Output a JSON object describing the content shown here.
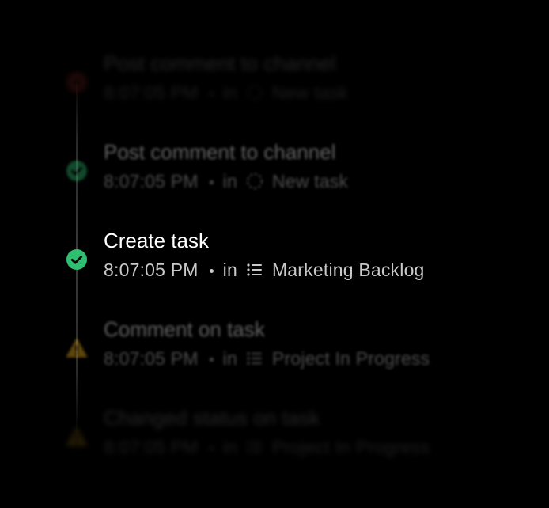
{
  "activity_feed": {
    "items": [
      {
        "title": "Post comment to channel",
        "time": "8:07:05 PM",
        "in_label": "in",
        "location": "New task",
        "location_icon": "dashed-circle-icon",
        "status": "error",
        "status_icon": "error-icon",
        "status_color": "#d63a3a"
      },
      {
        "title": "Post comment to channel",
        "time": "8:07:05 PM",
        "in_label": "in",
        "location": "New task",
        "location_icon": "dashed-circle-icon",
        "status": "success",
        "status_icon": "check-circle-icon",
        "status_color": "#2fbf71"
      },
      {
        "title": "Create task",
        "time": "8:07:05 PM",
        "in_label": "in",
        "location": "Marketing Backlog",
        "location_icon": "list-icon",
        "status": "success",
        "status_icon": "check-circle-icon",
        "status_color": "#2fbf71"
      },
      {
        "title": "Comment on task",
        "time": "8:07:05 PM",
        "in_label": "in",
        "location": "Project In Progress",
        "location_icon": "list-icon",
        "status": "warning",
        "status_icon": "warning-icon",
        "status_color": "#f5b820"
      },
      {
        "title": "Changed status on task",
        "time": "8:07:05 PM",
        "in_label": "in",
        "location": "Project In Progress",
        "location_icon": "list-icon",
        "status": "warning",
        "status_icon": "warning-icon",
        "status_color": "#f5b820"
      }
    ]
  }
}
